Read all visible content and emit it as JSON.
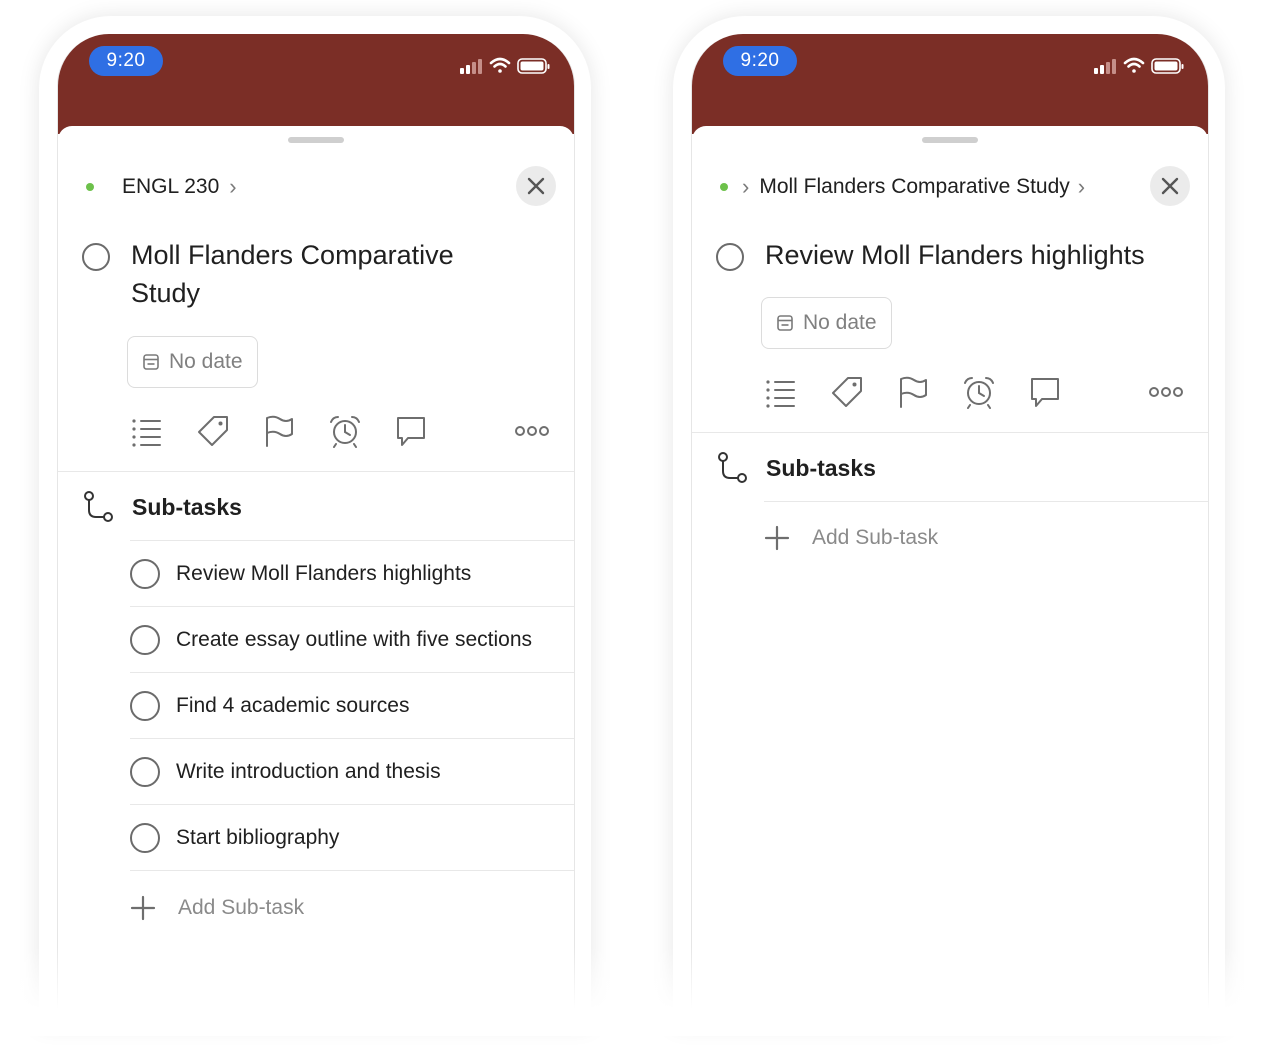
{
  "colors": {
    "status_bar": "#7b2e26",
    "time_pill": "#2f6fe4",
    "project_dot": "#6dc14b"
  },
  "left": {
    "status": {
      "time": "9:20"
    },
    "breadcrumb": {
      "project": "ENGL 230",
      "chevron": "›"
    },
    "task": {
      "title_line1": "Moll Flanders Comparative",
      "title_line2": "Study"
    },
    "date_chip": {
      "label": "No date",
      "icon": "calendar-icon"
    },
    "toolbar": [
      "list-icon",
      "tag-icon",
      "flag-icon",
      "alarm-icon",
      "comment-icon",
      "more-icon"
    ],
    "subtasks": {
      "title": "Sub-tasks",
      "items": [
        {
          "label": "Review Moll Flanders highlights"
        },
        {
          "label": "Create essay outline with five sections"
        },
        {
          "label": "Find 4 academic sources"
        },
        {
          "label": "Write introduction and thesis"
        },
        {
          "label": "Start bibliography"
        }
      ],
      "add_label": "Add Sub-task"
    }
  },
  "right": {
    "status": {
      "time": "9:20"
    },
    "breadcrumb": {
      "chevron_before": "›",
      "parent": "Moll Flanders Comparative Study",
      "chevron_after": "›"
    },
    "task": {
      "title": "Review Moll Flanders highlights"
    },
    "date_chip": {
      "label": "No date",
      "icon": "calendar-icon"
    },
    "toolbar": [
      "list-icon",
      "tag-icon",
      "flag-icon",
      "alarm-icon",
      "comment-icon",
      "more-icon"
    ],
    "subtasks": {
      "title": "Sub-tasks",
      "add_label": "Add Sub-task"
    }
  }
}
